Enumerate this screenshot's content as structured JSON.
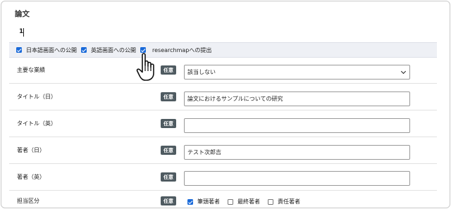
{
  "section_title": "論文",
  "record_count": "1",
  "publish": [
    {
      "label": "日本語画面への公開",
      "checked": true
    },
    {
      "label": "英語画面への公開",
      "checked": true
    },
    {
      "label": "researchmapへの提出",
      "checked": true
    }
  ],
  "optional_badge": "任意",
  "rows": {
    "achievement": {
      "label": "主要な業績",
      "value": "該当しない"
    },
    "title_ja": {
      "label": "タイトル（日）",
      "value": "論文におけるサンプルについての研究"
    },
    "title_en": {
      "label": "タイトル（英）",
      "value": ""
    },
    "author_ja": {
      "label": "著者（日）",
      "value": "テスト次郎吉"
    },
    "author_en": {
      "label": "著者（英）",
      "value": ""
    },
    "role": {
      "label": "担当区分"
    }
  },
  "roles": [
    {
      "label": "筆頭著者",
      "checked": true
    },
    {
      "label": "最終著者",
      "checked": false
    },
    {
      "label": "責任著者",
      "checked": false
    }
  ],
  "colors": {
    "checkbox_accent": "#1a6ad9",
    "badge_bg": "#4f5b61",
    "bar_bg": "#eef0f5"
  }
}
